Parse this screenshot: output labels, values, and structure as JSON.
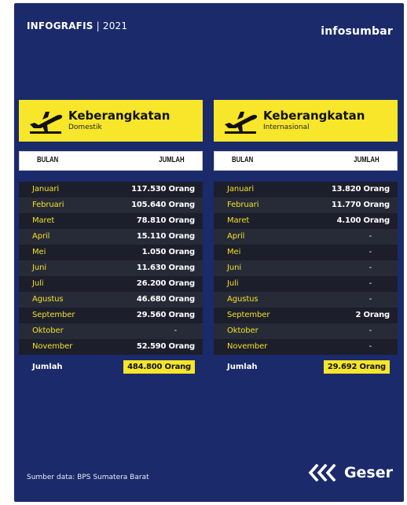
{
  "header": {
    "left_bold": "INFOGRAFIS",
    "left_rest": " | 2021",
    "brand": "infosumbar"
  },
  "colors": {
    "background": "#1a2a6a",
    "accent_yellow": "#f7e62a",
    "month_text": "#f2e02a"
  },
  "icons": {
    "plane": "airplane-departure-icon",
    "swipe": "triple-chevron-left-icon"
  },
  "panels": [
    {
      "title": "Keberangkatan",
      "subtitle": "Domestik",
      "col_bulan": "BULAN",
      "col_jumlah": "JUMLAH",
      "rows": [
        {
          "bulan": "Januari",
          "jumlah": "117.530 Orang"
        },
        {
          "bulan": "Februari",
          "jumlah": "105.640 Orang"
        },
        {
          "bulan": "Maret",
          "jumlah": "78.810 Orang"
        },
        {
          "bulan": "April",
          "jumlah": "15.110 Orang"
        },
        {
          "bulan": "Mei",
          "jumlah": "1.050 Orang"
        },
        {
          "bulan": "Juni",
          "jumlah": "11.630 Orang"
        },
        {
          "bulan": "Juli",
          "jumlah": "26.200 Orang"
        },
        {
          "bulan": "Agustus",
          "jumlah": "46.680 Orang"
        },
        {
          "bulan": "September",
          "jumlah": "29.560 Orang"
        },
        {
          "bulan": "Oktober",
          "jumlah": "-"
        },
        {
          "bulan": "November",
          "jumlah": "52.590 Orang"
        }
      ],
      "total_label": "Jumlah",
      "total_value": "484.800 Orang"
    },
    {
      "title": "Keberangkatan",
      "subtitle": "Internasional",
      "col_bulan": "BULAN",
      "col_jumlah": "JUMLAH",
      "rows": [
        {
          "bulan": "Januari",
          "jumlah": "13.820 Orang"
        },
        {
          "bulan": "Februari",
          "jumlah": "11.770 Orang"
        },
        {
          "bulan": "Maret",
          "jumlah": "4.100 Orang"
        },
        {
          "bulan": "April",
          "jumlah": "-"
        },
        {
          "bulan": "Mei",
          "jumlah": "-"
        },
        {
          "bulan": "Juni",
          "jumlah": "-"
        },
        {
          "bulan": "Juli",
          "jumlah": "-"
        },
        {
          "bulan": "Agustus",
          "jumlah": "-"
        },
        {
          "bulan": "September",
          "jumlah": "2 Orang"
        },
        {
          "bulan": "Oktober",
          "jumlah": "-"
        },
        {
          "bulan": "November",
          "jumlah": "-"
        }
      ],
      "total_label": "Jumlah",
      "total_value": "29.692 Orang"
    }
  ],
  "footer": {
    "source": "Sumber data: BPS Sumatera Barat",
    "swipe_label": "Geser"
  }
}
